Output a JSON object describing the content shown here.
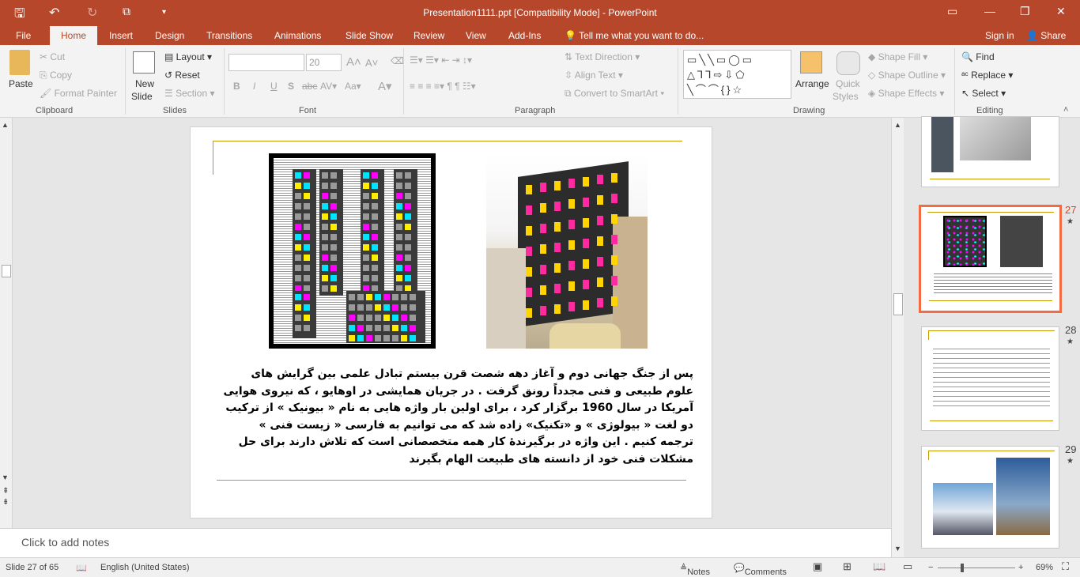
{
  "window": {
    "title": "Presentation1111.ppt [Compatibility Mode] - PowerPoint"
  },
  "tabs": [
    "File",
    "Home",
    "Insert",
    "Design",
    "Transitions",
    "Animations",
    "Slide Show",
    "Review",
    "View",
    "Add-Ins"
  ],
  "tell_me": "Tell me what you want to do...",
  "sign_in": "Sign in",
  "share": "Share",
  "ribbon": {
    "clipboard": {
      "paste": "Paste",
      "cut": "Cut",
      "copy": "Copy",
      "format_painter": "Format Painter",
      "label": "Clipboard"
    },
    "slides": {
      "new_slide": "New",
      "new_slide2": "Slide",
      "layout": "Layout",
      "reset": "Reset",
      "section": "Section",
      "label": "Slides"
    },
    "font": {
      "font_name": "",
      "font_size": "20",
      "label": "Font"
    },
    "paragraph": {
      "text_direction": "Text Direction",
      "align_text": "Align Text",
      "smartart": "Convert to SmartArt",
      "label": "Paragraph"
    },
    "drawing": {
      "arrange": "Arrange",
      "quick_styles": "Quick",
      "quick_styles2": "Styles",
      "shape_fill": "Shape Fill",
      "shape_outline": "Shape Outline",
      "shape_effects": "Shape Effects",
      "label": "Drawing"
    },
    "editing": {
      "find": "Find",
      "replace": "Replace",
      "select": "Select",
      "label": "Editing"
    }
  },
  "slide": {
    "body": "پس از جنگ جهانی دوم و آغاز دهه شصت قرن بیستم تبادل علمی بین گرایش های علوم طبیعی و فنی مجدداً رونق گرفت . در جریان همایشی در اوهایو ، که نیروی هوایی آمریکا در سال 1960 برگزار کرد ، برای اولین بار واژه هایی به نام « بیونیک » از ترکیب دو لغت « بیولوژی » و «تکنیک» زاده شد که می توانیم به فارسی « زیست فنی » ترجمه کنیم . این واژه در برگیرندهٔ کار همه متخصصانی است که تلاش دارند برای حل مشکلات فنی خود از دانسته های طبیعت الهام بگیرند"
  },
  "notes_placeholder": "Click to add notes",
  "thumbnails": [
    {
      "num": "27",
      "star": "★"
    },
    {
      "num": "28",
      "star": "★"
    },
    {
      "num": "29",
      "star": "★"
    }
  ],
  "status": {
    "slide": "Slide 27 of 65",
    "language": "English (United States)",
    "notes": "Notes",
    "comments": "Comments",
    "zoom": "69%"
  },
  "colors": {
    "accent": "#b7472a",
    "selected_thumb": "#f26b43",
    "gold_rule": "#c49a00"
  }
}
